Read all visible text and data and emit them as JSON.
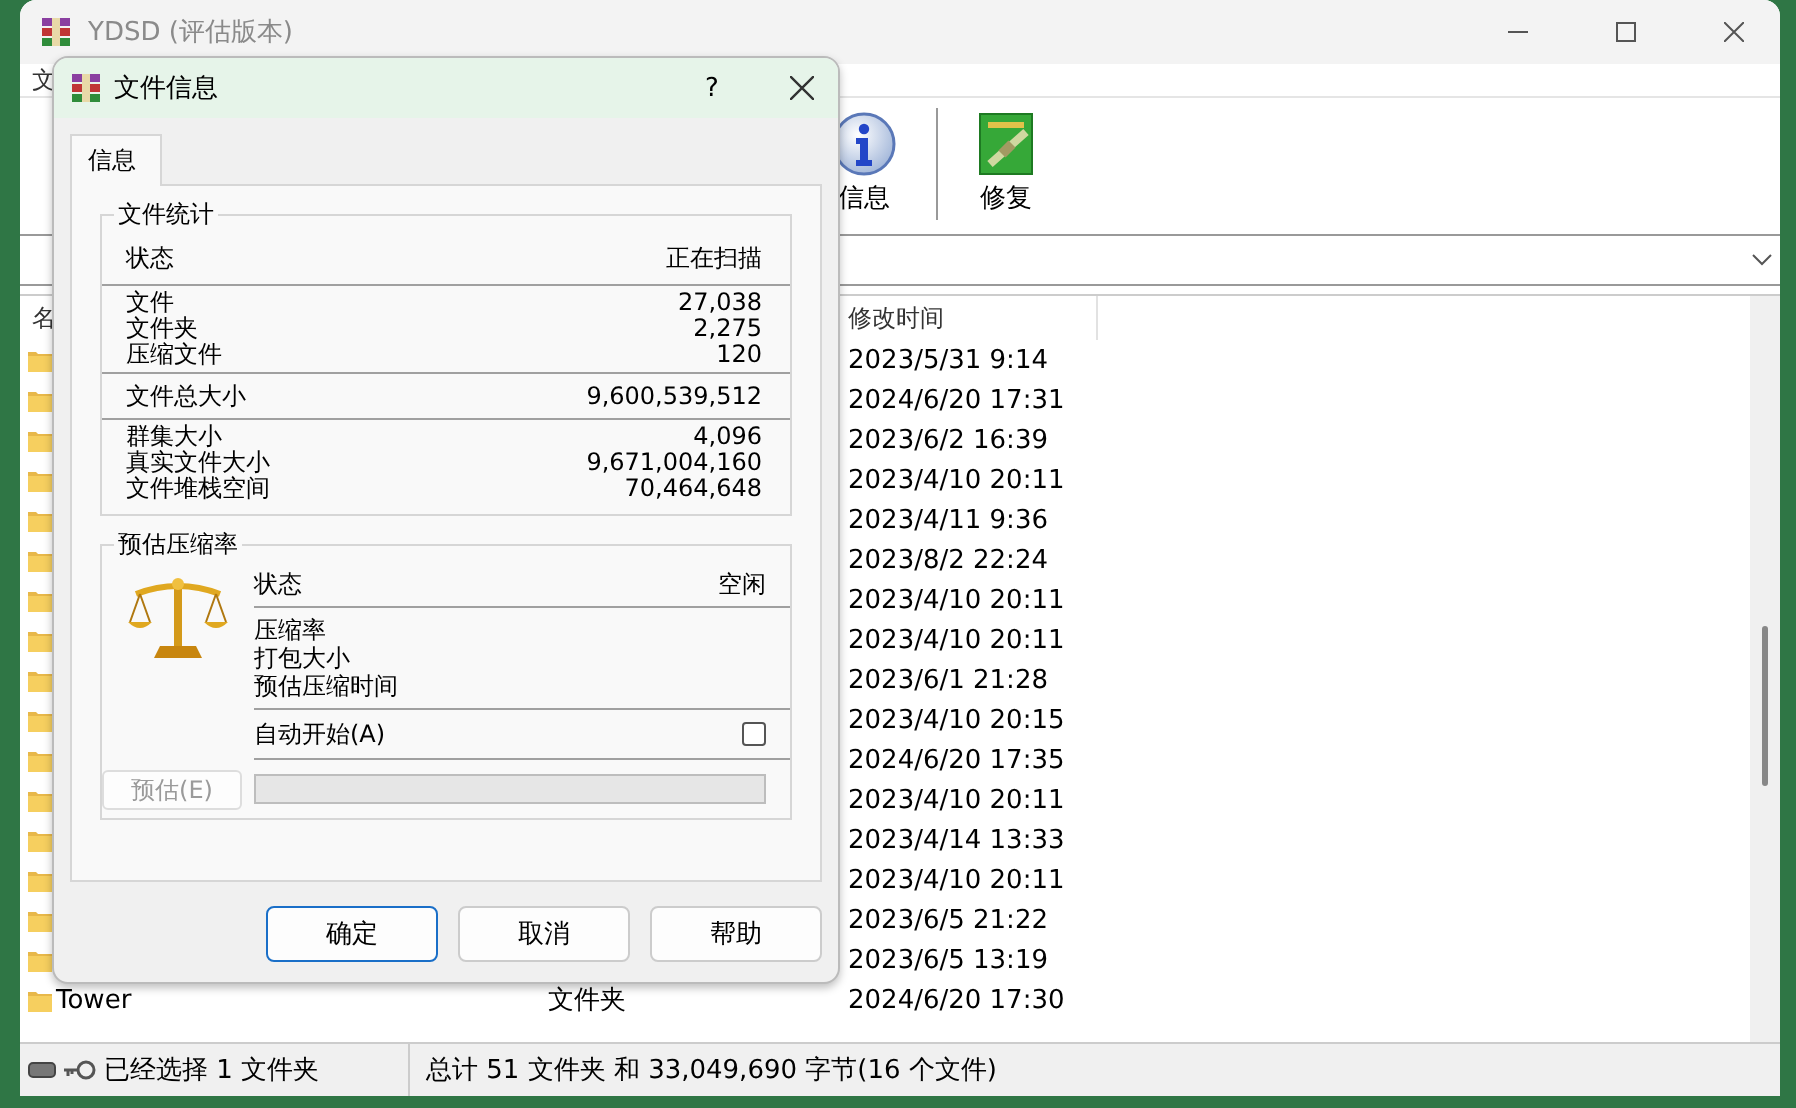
{
  "window": {
    "title": "YDSD (评估版本)"
  },
  "menu": [
    "文"
  ],
  "toolbar": [
    {
      "label": "信息",
      "kind": "info"
    },
    {
      "label": "修复",
      "kind": "repair"
    }
  ],
  "file_list": {
    "columns": [
      "名",
      "修改时间"
    ],
    "rows": [
      {
        "modified": "2023/5/31 9:14"
      },
      {
        "modified": "2024/6/20 17:31"
      },
      {
        "modified": "2023/6/2 16:39"
      },
      {
        "modified": "2023/4/10 20:11"
      },
      {
        "modified": "2023/4/11 9:36"
      },
      {
        "modified": "2023/8/2 22:24"
      },
      {
        "modified": "2023/4/10 20:11"
      },
      {
        "modified": "2023/4/10 20:11"
      },
      {
        "modified": "2023/6/1 21:28"
      },
      {
        "modified": "2023/4/10 20:15"
      },
      {
        "modified": "2024/6/20 17:35"
      },
      {
        "modified": "2023/4/10 20:11"
      },
      {
        "modified": "2023/4/14 13:33"
      },
      {
        "modified": "2023/4/10 20:11"
      },
      {
        "modified": "2023/6/5 21:22"
      },
      {
        "modified": "2023/6/5 13:19"
      },
      {
        "name": "Tower",
        "type": "文件夹",
        "modified": "2024/6/20 17:30"
      }
    ]
  },
  "status_bar": {
    "selection": "已经选择 1 文件夹",
    "total": "总计 51 文件夹 和 33,049,690 字节(16 个文件)"
  },
  "dialog": {
    "title": "文件信息",
    "help": "?",
    "tabs": [
      {
        "label": "信息",
        "selected": true
      }
    ],
    "stats_group": {
      "title": "文件统计",
      "sections": [
        [
          {
            "label": "状态",
            "value": "正在扫描"
          }
        ],
        [
          {
            "label": "文件",
            "value": "27,038"
          },
          {
            "label": "文件夹",
            "value": "2,275"
          },
          {
            "label": "压缩文件",
            "value": "120"
          }
        ],
        [
          {
            "label": "文件总大小",
            "value": "9,600,539,512"
          }
        ],
        [
          {
            "label": "群集大小",
            "value": "4,096"
          },
          {
            "label": "真实文件大小",
            "value": "9,671,004,160"
          },
          {
            "label": "文件堆栈空间",
            "value": "70,464,648"
          }
        ]
      ]
    },
    "estimate_group": {
      "title": "预估压缩率",
      "status": {
        "label": "状态",
        "value": "空闲"
      },
      "fields": [
        "压缩率",
        "打包大小",
        "预估压缩时间"
      ],
      "auto_start": {
        "label": "自动开始(A)",
        "checked": false
      },
      "estimate_button": {
        "label": "预估(E)",
        "disabled": true
      },
      "progress": {
        "level": 0
      }
    },
    "buttons": [
      {
        "label": "确定",
        "default": true
      },
      {
        "label": "取消",
        "default": false
      },
      {
        "label": "帮助",
        "default": false
      }
    ]
  }
}
